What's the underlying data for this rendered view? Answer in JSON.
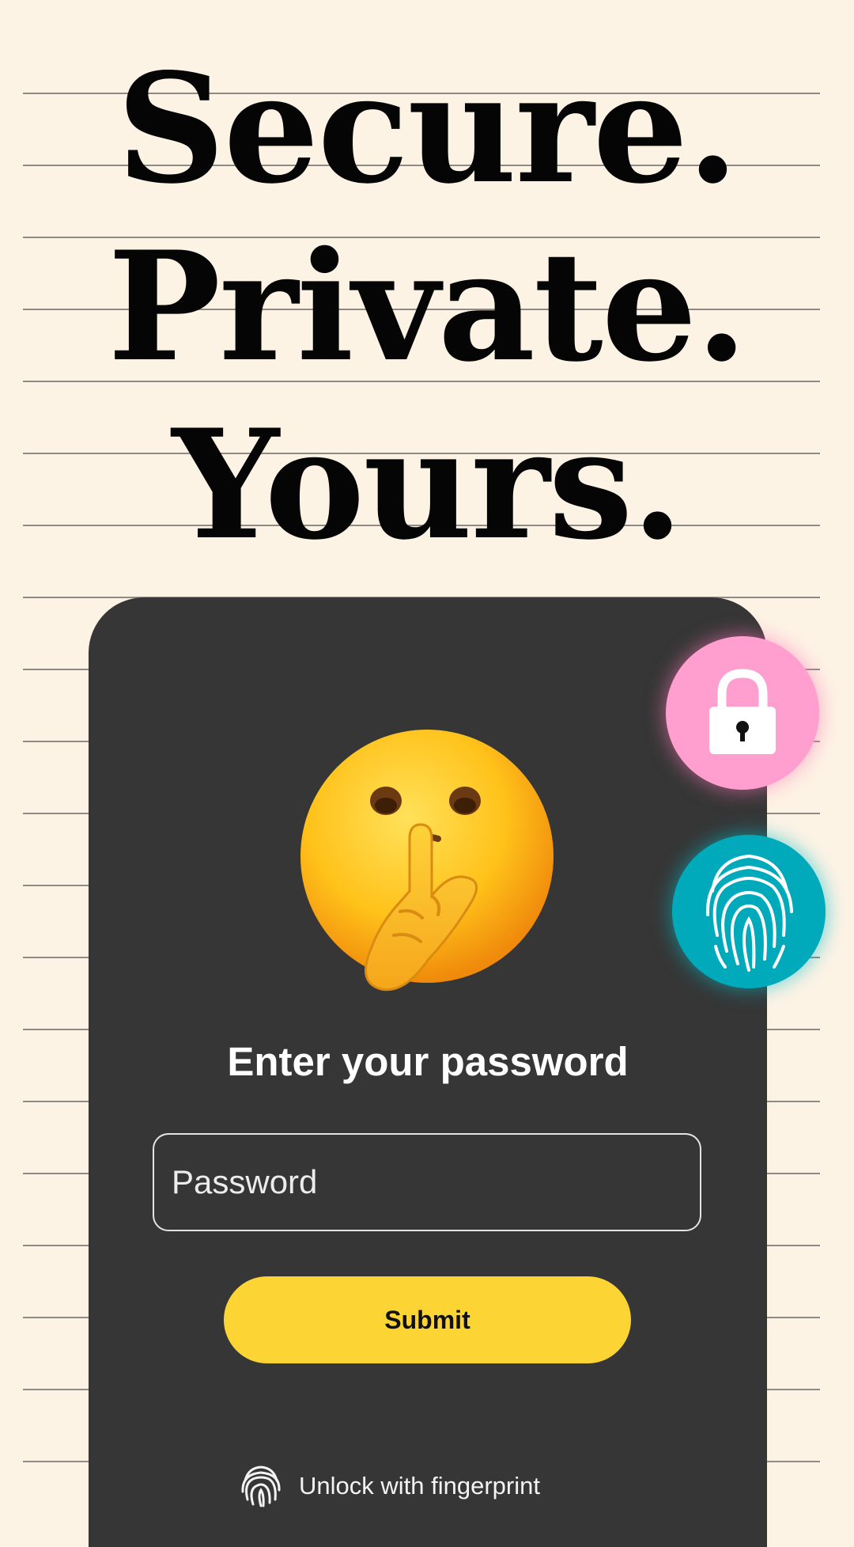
{
  "headline": {
    "line1": "Secure.",
    "line2": "Private.",
    "line3": "Yours."
  },
  "login": {
    "prompt": "Enter your password",
    "password_placeholder": "Password",
    "submit_label": "Submit",
    "fingerprint_link_label": "Unlock with fingerprint"
  },
  "icons": {
    "emoji": "shushing-face-emoji",
    "lock": "lock-icon",
    "fingerprint": "fingerprint-icon"
  },
  "colors": {
    "background": "#fdf3e5",
    "card": "#363636",
    "submit": "#fcd535",
    "lock_button": "#ff9fcf",
    "fingerprint_button": "#00aabb"
  }
}
